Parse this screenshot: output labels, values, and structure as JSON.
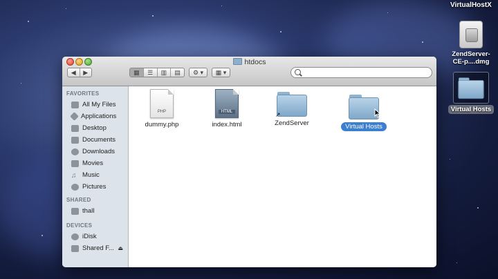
{
  "desktop": {
    "top_label": "VirtualHostX",
    "items": [
      {
        "label": "ZendServer-CE-p....dmg",
        "line1": "ZendServer-",
        "line2": "CE-p....dmg",
        "icon": "dmg-icon"
      },
      {
        "label": "Virtual Hosts",
        "icon": "folder-icon",
        "selected": true
      }
    ]
  },
  "window": {
    "title": "htdocs",
    "toolbar": {
      "back": "◀",
      "forward": "▶",
      "view_modes": [
        "icon-view",
        "list-view",
        "column-view",
        "coverflow-view"
      ],
      "action_label": "⚙ ▾",
      "arrange_label": "▦ ▾",
      "search_placeholder": ""
    },
    "sidebar": {
      "sections": [
        {
          "title": "FAVORITES",
          "items": [
            {
              "label": "All My Files",
              "icon": "all-files-icon"
            },
            {
              "label": "Applications",
              "icon": "applications-icon"
            },
            {
              "label": "Desktop",
              "icon": "desktop-icon"
            },
            {
              "label": "Documents",
              "icon": "documents-icon"
            },
            {
              "label": "Downloads",
              "icon": "downloads-icon"
            },
            {
              "label": "Movies",
              "icon": "movies-icon"
            },
            {
              "label": "Music",
              "icon": "music-icon"
            },
            {
              "label": "Pictures",
              "icon": "pictures-icon"
            }
          ]
        },
        {
          "title": "SHARED",
          "items": [
            {
              "label": "thall",
              "icon": "computer-icon"
            }
          ]
        },
        {
          "title": "DEVICES",
          "items": [
            {
              "label": "iDisk",
              "icon": "idisk-icon"
            },
            {
              "label": "Shared F...",
              "icon": "drive-icon",
              "eject": "⏏"
            }
          ]
        }
      ]
    },
    "files": [
      {
        "name": "dummy.php",
        "kind": "doc",
        "tag": "PHP"
      },
      {
        "name": "index.html",
        "kind": "doc",
        "tag": "HTML"
      },
      {
        "name": "ZendServer",
        "kind": "folder-alias",
        "alias_mark": "↗"
      },
      {
        "name": "Virtual Hosts",
        "kind": "folder",
        "selected": true
      }
    ]
  }
}
